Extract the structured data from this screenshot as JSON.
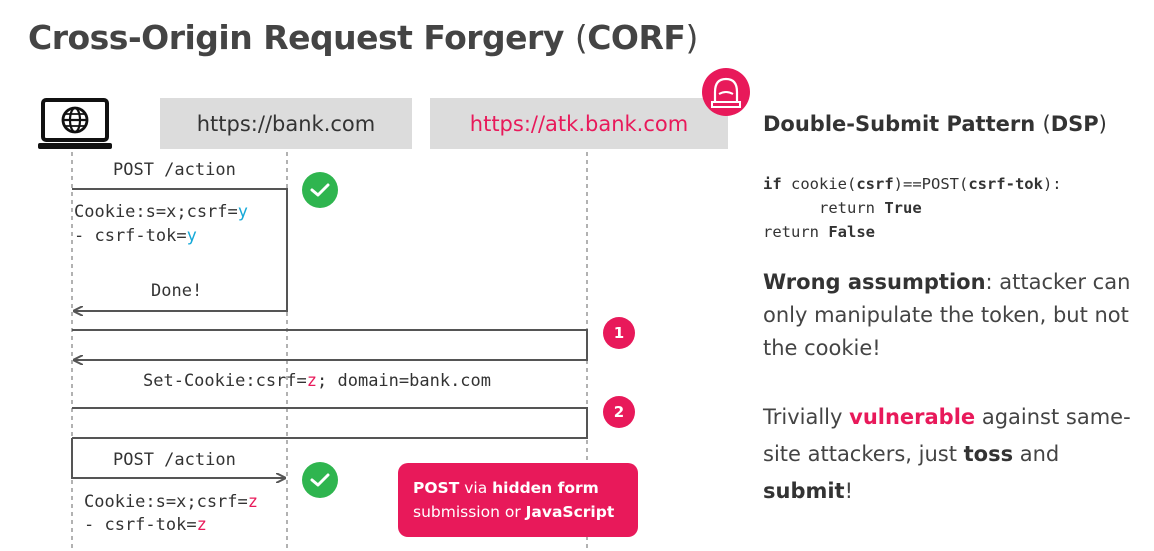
{
  "title": {
    "main": "Cross-Origin Request Forgery",
    "abbr": "CORF"
  },
  "origins": {
    "bank": "https://bank.com",
    "attacker": "https://atk.bank.com"
  },
  "colors": {
    "accent": "#e8195a",
    "cyan": "#16a9d8",
    "check": "#2fb54f",
    "header_bg": "#dcdcdc"
  },
  "icons": {
    "client": "laptop-globe-icon",
    "attacker": "hacker-icon",
    "ok": "check-icon"
  },
  "flow1": {
    "request_label": "POST /action",
    "cookie_prefix": "Cookie:s=x;csrf=",
    "cookie_value": "y",
    "token_prefix": "- csrf-tok=",
    "token_value": "y",
    "response_label": "Done!"
  },
  "steps": {
    "one": "1",
    "two": "2"
  },
  "set_cookie": {
    "prefix": "Set-Cookie:csrf=",
    "value": "z",
    "suffix": "; domain=bank.com"
  },
  "flow2": {
    "request_label": "POST /action",
    "cookie_prefix": "Cookie:s=x;csrf=",
    "cookie_value": "z",
    "token_prefix": "- csrf-tok=",
    "token_value": "z"
  },
  "callout": {
    "b1": "POST",
    "t1": " via ",
    "b2": "hidden form",
    "t2": "submission or ",
    "b3": "JavaScript"
  },
  "right": {
    "heading": "Double-Submit Pattern",
    "heading_abbr": "DSP",
    "code": {
      "l1_kw": "if",
      "l1_a": " cookie(",
      "l1_b": "csrf",
      "l1_c": ")==POST(",
      "l1_d": "csrf-tok",
      "l1_e": "):",
      "l2_a": "      return ",
      "l2_b": "True",
      "l3_a": "return ",
      "l3_b": "False"
    },
    "p1": {
      "bold": "Wrong assumption",
      "rest": ": attacker can only manipulate the token, but not the cookie!"
    },
    "p2": {
      "a": "Trivially ",
      "vuln": "vulnerable",
      "b": " against same-site attackers, just ",
      "toss": "toss",
      "c": " and ",
      "submit": "submit",
      "d": "!"
    }
  }
}
